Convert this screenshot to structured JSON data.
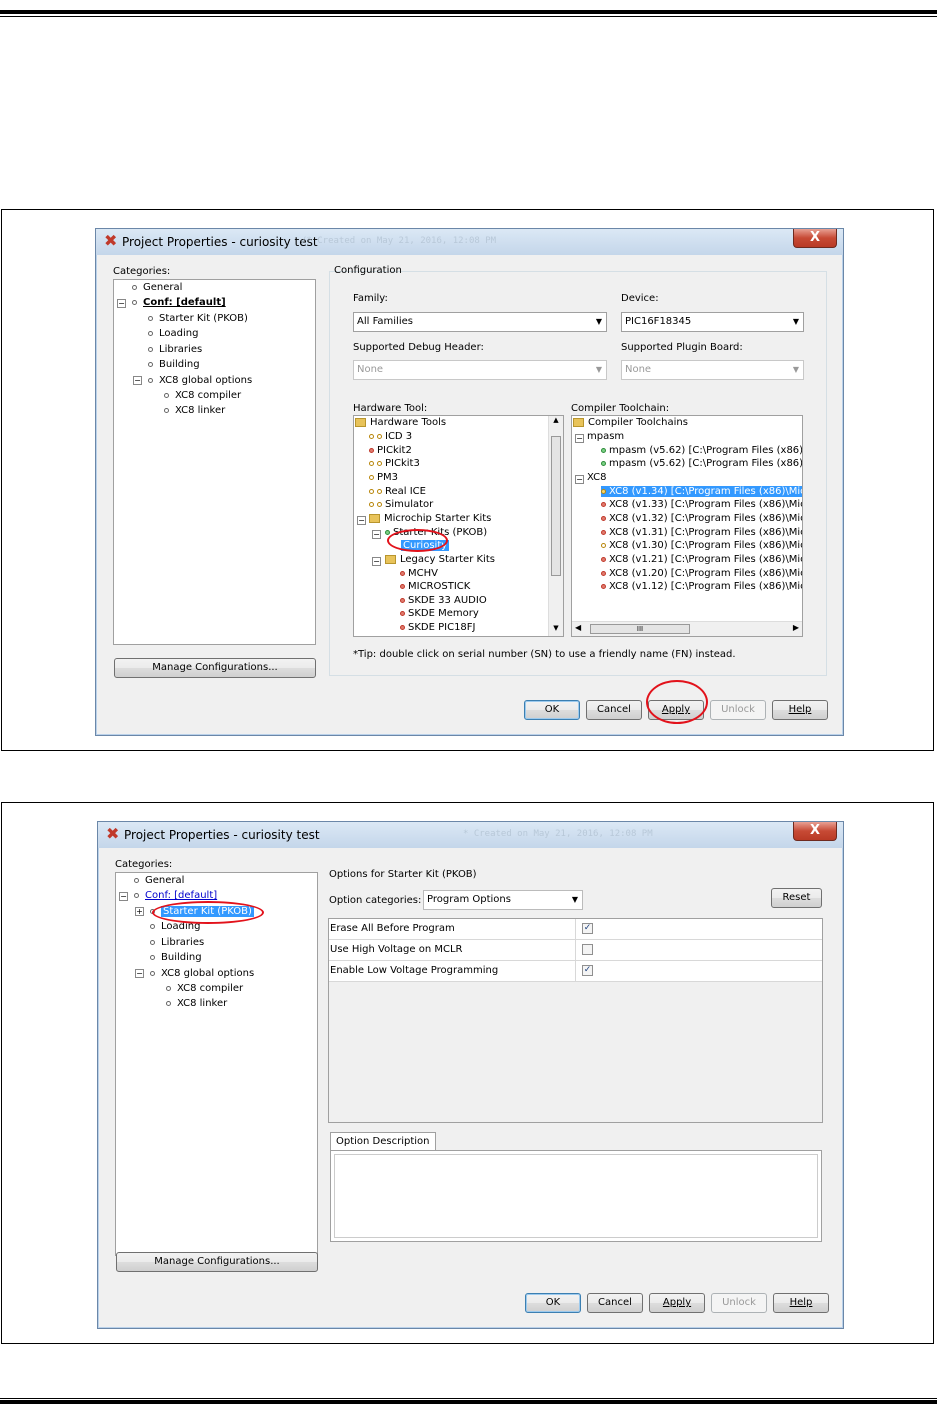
{
  "dialog1": {
    "title": "Project Properties - curiosity test",
    "close": "X",
    "bg_text": "/* Created on May 21, 2016, 12:08 PM",
    "categories_label": "Categories:",
    "tree": [
      {
        "label": "General"
      },
      {
        "label": "Conf: [default]"
      },
      {
        "label": "Starter Kit (PKOB)"
      },
      {
        "label": "Loading"
      },
      {
        "label": "Libraries"
      },
      {
        "label": "Building"
      },
      {
        "label": "XC8 global options"
      },
      {
        "label": "XC8 compiler"
      },
      {
        "label": "XC8 linker"
      }
    ],
    "manage_button": "Manage Configurations...",
    "configuration_label": "Configuration",
    "family_label": "Family:",
    "family_value": "All Families",
    "device_label": "Device:",
    "device_value": "PIC16F18345",
    "debug_header_label": "Supported Debug Header:",
    "debug_header_value": "None",
    "plugin_board_label": "Supported Plugin Board:",
    "plugin_board_value": "None",
    "hardware_tool_label": "Hardware Tool:",
    "hardware_tools": [
      "Hardware Tools",
      "ICD 3",
      "PICkit2",
      "PICkit3",
      "PM3",
      "Real ICE",
      "Simulator",
      "Microchip Starter Kits",
      "Starter Kits (PKOB)",
      "Curiosity",
      "Legacy Starter Kits",
      "MCHV",
      "MICROSTICK",
      "SKDE 33 AUDIO",
      "SKDE Memory",
      "SKDE PIC18FJ"
    ],
    "compiler_toolchain_label": "Compiler Toolchain:",
    "compiler_toolchains": [
      "Compiler Toolchains",
      "mpasm",
      "mpasm (v5.62) [C:\\Program Files (x86)\\",
      "mpasm (v5.62) [C:\\Program Files (x86)\\",
      "XC8",
      "XC8 (v1.34) [C:\\Program Files (x86)\\Mic",
      "XC8 (v1.33) [C:\\Program Files (x86)\\Mic",
      "XC8 (v1.32) [C:\\Program Files (x86)\\Mic",
      "XC8 (v1.31) [C:\\Program Files (x86)\\Mic",
      "XC8 (v1.30) [C:\\Program Files (x86)\\Mic",
      "XC8 (v1.21) [C:\\Program Files (x86)\\Mic",
      "XC8 (v1.20) [C:\\Program Files (x86)\\Mic",
      "XC8 (v1.12) [C:\\Program Files (x86)\\Mic"
    ],
    "scroll_thumb": "III",
    "tip": "*Tip: double click on serial number (SN) to use a friendly name (FN) instead.",
    "ok": "OK",
    "cancel": "Cancel",
    "apply": "Apply",
    "unlock": "Unlock",
    "help": "Help"
  },
  "dialog2": {
    "title": "Project Properties - curiosity test",
    "close": "X",
    "bg_text": "* Created on May 21, 2016, 12:08 PM",
    "categories_label": "Categories:",
    "tree": [
      {
        "label": "General"
      },
      {
        "label": "Conf: [default]"
      },
      {
        "label": "Starter Kit (PKOB)"
      },
      {
        "label": "Loading"
      },
      {
        "label": "Libraries"
      },
      {
        "label": "Building"
      },
      {
        "label": "XC8 global options"
      },
      {
        "label": "XC8 compiler"
      },
      {
        "label": "XC8 linker"
      }
    ],
    "manage_button": "Manage Configurations...",
    "options_for": "Options for Starter Kit (PKOB)",
    "option_categories_label": "Option categories:",
    "option_categories_value": "Program Options",
    "reset": "Reset",
    "options": [
      {
        "label": "Erase All Before Program",
        "checked": true
      },
      {
        "label": "Use High Voltage on MCLR",
        "checked": false
      },
      {
        "label": "Enable Low Voltage Programming",
        "checked": true
      }
    ],
    "option_description_tab": "Option Description",
    "ok": "OK",
    "cancel": "Cancel",
    "apply": "Apply",
    "unlock": "Unlock",
    "help": "Help"
  }
}
